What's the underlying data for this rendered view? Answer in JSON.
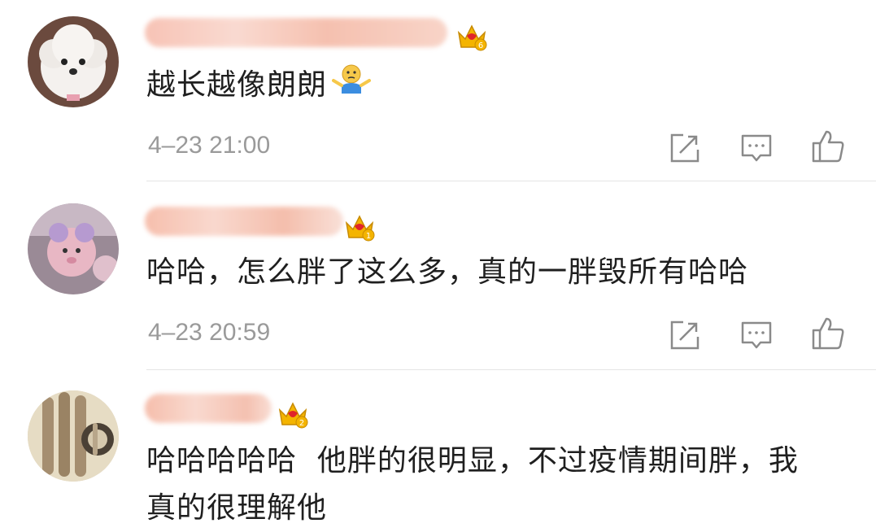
{
  "comments": [
    {
      "text": "越长越像朗朗",
      "emoji_icon": "shrug-emoji-icon",
      "time": "4–23 21:00",
      "badge_level": "6"
    },
    {
      "text": "哈哈，怎么胖了这么多，真的一胖毁所有哈哈",
      "time": "4–23 20:59",
      "badge_level": "1"
    },
    {
      "text_line1": "哈哈哈哈哈  他胖的很明显，不过疫情期间胖，我",
      "text_line2": "真的很理解他",
      "badge_level": "2"
    }
  ],
  "colors": {
    "crown_gold": "#f4b400",
    "crown_red": "#e0242b",
    "icon_gray": "#8a8a8a",
    "time_gray": "#9a9a9a"
  }
}
